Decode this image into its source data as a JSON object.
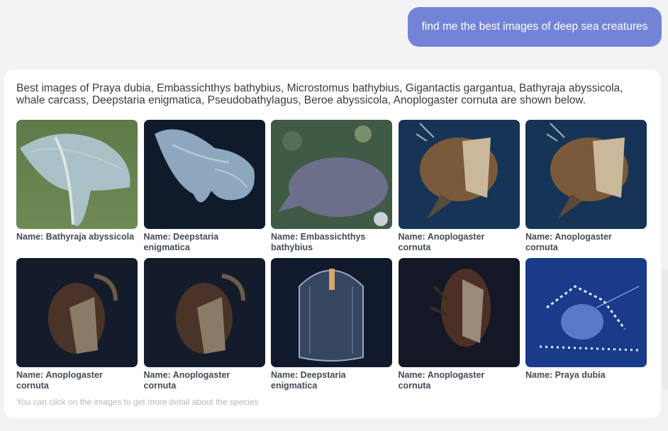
{
  "user_message": "find me the best images of deep sea creatures",
  "answer": {
    "intro": "Best images of Praya dubia, Embassichthys bathybius, Microstomus bathybius, Gigantactis gargantua, Bathyraja abyssicola, whale carcass, Deepstaria enigmatica, Pseudobathylagus, Beroe abyssicola, Anoplogaster cornuta are shown below.",
    "hint": "You can click on the images to get more detail about the species",
    "images": [
      {
        "caption": "Name: Bathyraja abyssicola",
        "kind": "ray"
      },
      {
        "caption": "Name: Deepstaria enigmatica",
        "kind": "deepstaria"
      },
      {
        "caption": "Name: Embassichthys bathybius",
        "kind": "flatfish"
      },
      {
        "caption": "Name: Anoplogaster cornuta",
        "kind": "fangtooth"
      },
      {
        "caption": "Name: Anoplogaster cornuta",
        "kind": "fangtooth"
      },
      {
        "caption": "Name: Anoplogaster cornuta",
        "kind": "fangtooth-dark"
      },
      {
        "caption": "Name: Anoplogaster cornuta",
        "kind": "fangtooth-dark"
      },
      {
        "caption": "Name: Deepstaria enigmatica",
        "kind": "jelly"
      },
      {
        "caption": "Name: Anoplogaster cornuta",
        "kind": "fangtooth-dark2"
      },
      {
        "caption": "Name: Praya dubia",
        "kind": "siphonophore"
      }
    ]
  },
  "colors": {
    "user_bubble": "#7384d8",
    "page_bg": "#f3f3f6",
    "caption": "#444a55",
    "hint": "#b5b8c4"
  }
}
